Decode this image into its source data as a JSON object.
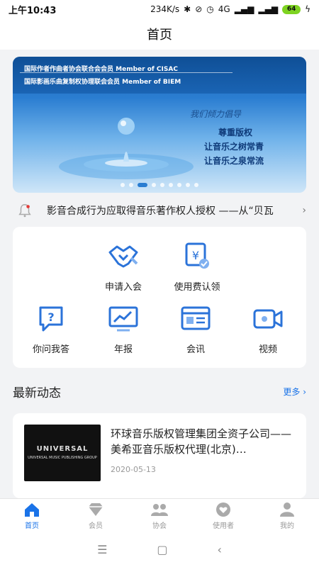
{
  "status": {
    "time": "上午10:43",
    "speed": "234K/s",
    "network": "4G",
    "battery": "64"
  },
  "title": "首页",
  "banner": {
    "line1": "国际作者作曲者协会联合会会员 Member of CISAC",
    "line2": "国际影画乐曲复制权协理联会会员 Member of BIEM",
    "slogan": "我们倾力倡导",
    "motto1": "尊重版权",
    "motto2": "让音乐之树常青",
    "motto3": "让音乐之泉常流",
    "dot_count": 9,
    "active_dot": 2
  },
  "notice": {
    "text": "影音合成行为应取得音乐著作权人授权 ——从“贝瓦",
    "chevron": "›"
  },
  "menu": [
    {
      "label": "申请入会",
      "icon": "handshake-icon"
    },
    {
      "label": "使用费认领",
      "icon": "yen-check-icon"
    },
    {
      "label": "你问我答",
      "icon": "question-icon"
    },
    {
      "label": "年报",
      "icon": "report-icon"
    },
    {
      "label": "会讯",
      "icon": "newsletter-icon"
    },
    {
      "label": "视频",
      "icon": "video-icon"
    }
  ],
  "section": {
    "title": "最新动态",
    "more": "更多 ›"
  },
  "news": {
    "title": "环球音乐版权管理集团全资子公司——美希亚音乐版权代理(北京)…",
    "date": "2020-05-13",
    "thumb_brand": "UNIVERSAL",
    "thumb_sub": "UNIVERSAL MUSIC PUBLISHING GROUP"
  },
  "tabs": [
    {
      "label": "首页",
      "icon": "home-icon",
      "active": true
    },
    {
      "label": "会员",
      "icon": "diamond-icon",
      "active": false
    },
    {
      "label": "协会",
      "icon": "group-icon",
      "active": false
    },
    {
      "label": "使用者",
      "icon": "heart-icon",
      "active": false
    },
    {
      "label": "我的",
      "icon": "person-icon",
      "active": false
    }
  ],
  "colors": {
    "accent": "#1a73e8",
    "icon_blue": "#2b73d9"
  }
}
